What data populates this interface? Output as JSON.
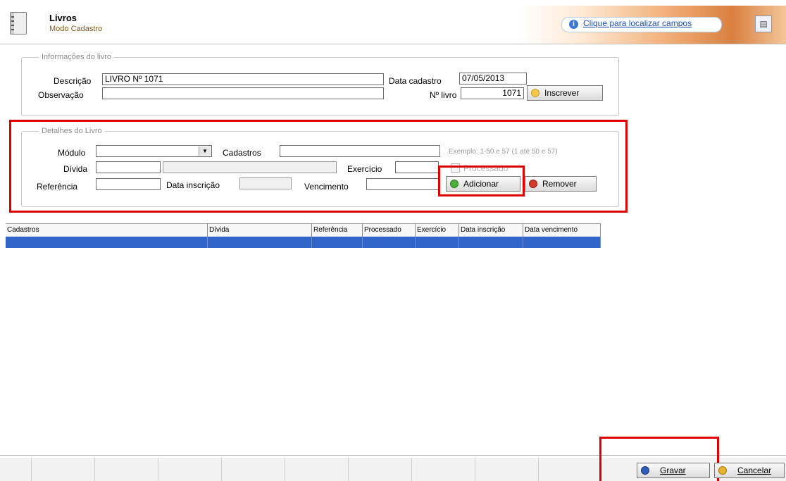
{
  "header": {
    "title": "Livros",
    "subtitle": "Modo Cadastro",
    "locate_link": "Clique para localizar campos"
  },
  "info_group": {
    "legend": "Informações do livro",
    "descricao_label": "Descrição",
    "descricao_value": "LIVRO Nº 1071",
    "observacao_label": "Observação",
    "observacao_value": "",
    "data_cadastro_label": "Data cadastro",
    "data_cadastro_value": "07/05/2013",
    "num_livro_label": "Nº livro",
    "num_livro_value": "1071",
    "inscrever_label": "Inscrever"
  },
  "details_group": {
    "legend": "Detalhes do Livro",
    "modulo_label": "Módulo",
    "modulo_value": "",
    "cadastros_label": "Cadastros",
    "cadastros_value": "",
    "example_hint": "Exemplo: 1-50 e 57 (1 até 50 e 57)",
    "divida_label": "Dívida",
    "exercicio_label": "Exercício",
    "processado_label": "Processado",
    "referencia_label": "Referência",
    "data_inscricao_label": "Data inscrição",
    "vencimento_label": "Vencimento",
    "adicionar_label": "Adicionar",
    "remover_label": "Remover"
  },
  "grid": {
    "columns": [
      "Cadastros",
      "Dívida",
      "Referência",
      "Processado",
      "Exercício",
      "Data inscrição",
      "Data vencimento"
    ]
  },
  "footer": {
    "gravar_label": "Gravar",
    "cancelar_label": "Cancelar"
  },
  "colors": {
    "highlight_red": "#e00000",
    "selection_blue": "#2f66c7",
    "link_blue": "#1b4fb3"
  }
}
